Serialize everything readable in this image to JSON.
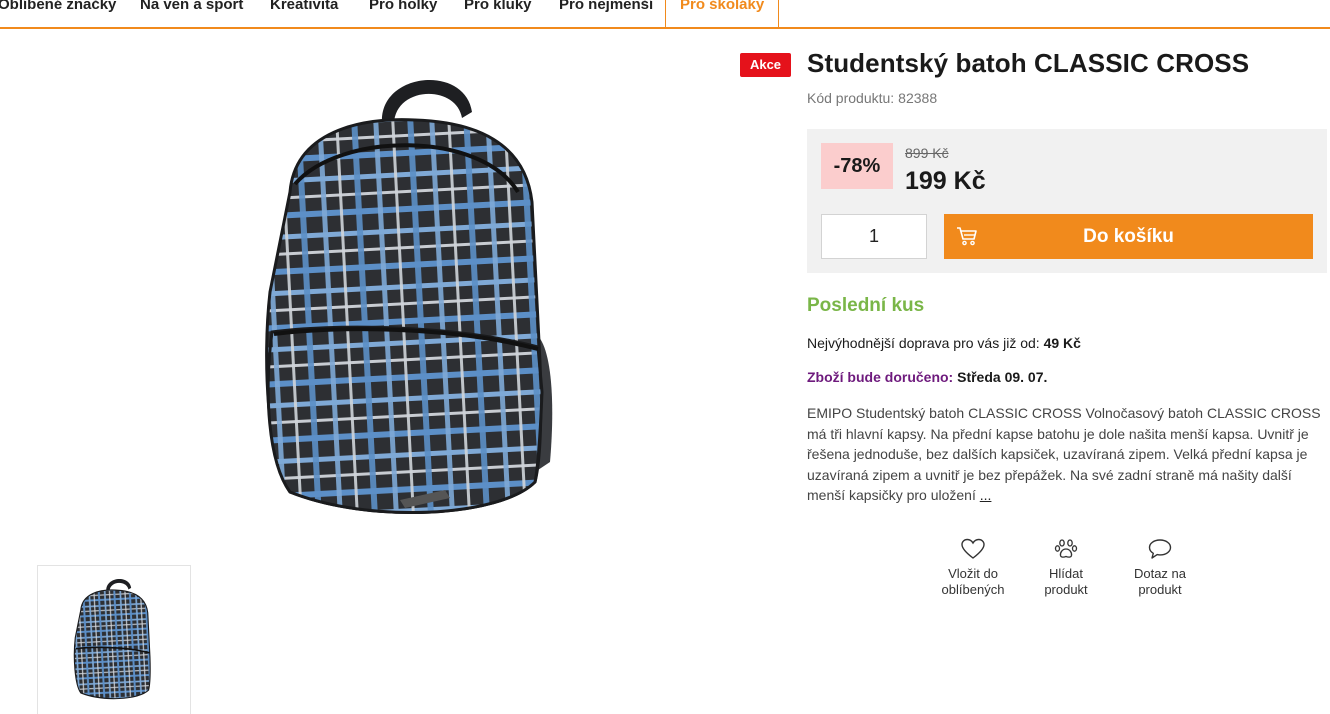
{
  "nav": {
    "items": [
      "Oblíbené značky",
      "Na ven a sport",
      "Kreativita",
      "Pro holky",
      "Pro kluky",
      "Pro nejmenší",
      "Pro školáky"
    ],
    "active": "Pro školáky"
  },
  "product": {
    "badge": "Akce",
    "title": "Studentský batoh CLASSIC CROSS",
    "code_label": "Kód produktu:",
    "code_value": "82388",
    "discount": "-78%",
    "old_price": "899 Kč",
    "price": "199 Kč",
    "quantity": "1",
    "cart_label": "Do košíku",
    "stock": "Poslední kus",
    "shipping_text": "Nejvýhodnější doprava pro vás již od:",
    "shipping_price": "49 Kč",
    "delivery_label": "Zboží bude doručeno:",
    "delivery_date": "Středa 09. 07.",
    "description": "EMIPO Studentský batoh CLASSIC CROSS Volnočasový batoh CLASSIC CROSS má tři hlavní kapsy. Na přední kapse batohu je dole našita menší kapsa. Uvnitř je řešena jednoduše, bez dalších kapsiček, uzavíraná zipem. Velká přední kapsa je uzavíraná zipem a uvnitř je bez přepážek. Na své zadní straně má našity další menší kapsičky pro uložení",
    "more": "..."
  },
  "actions": [
    {
      "icon": "heart-icon",
      "line1": "Vložit do",
      "line2": "oblíbených"
    },
    {
      "icon": "paw-icon",
      "line1": "Hlídat",
      "line2": "produkt"
    },
    {
      "icon": "chat-bubble-icon",
      "line1": "Dotaz na",
      "line2": "produkt"
    }
  ],
  "colors": {
    "accent": "#f18a1c",
    "sale_badge": "#e5121b",
    "discount_bg": "#fbcdcd",
    "stock": "#7ab648",
    "delivery_label": "#6e1a7d"
  }
}
